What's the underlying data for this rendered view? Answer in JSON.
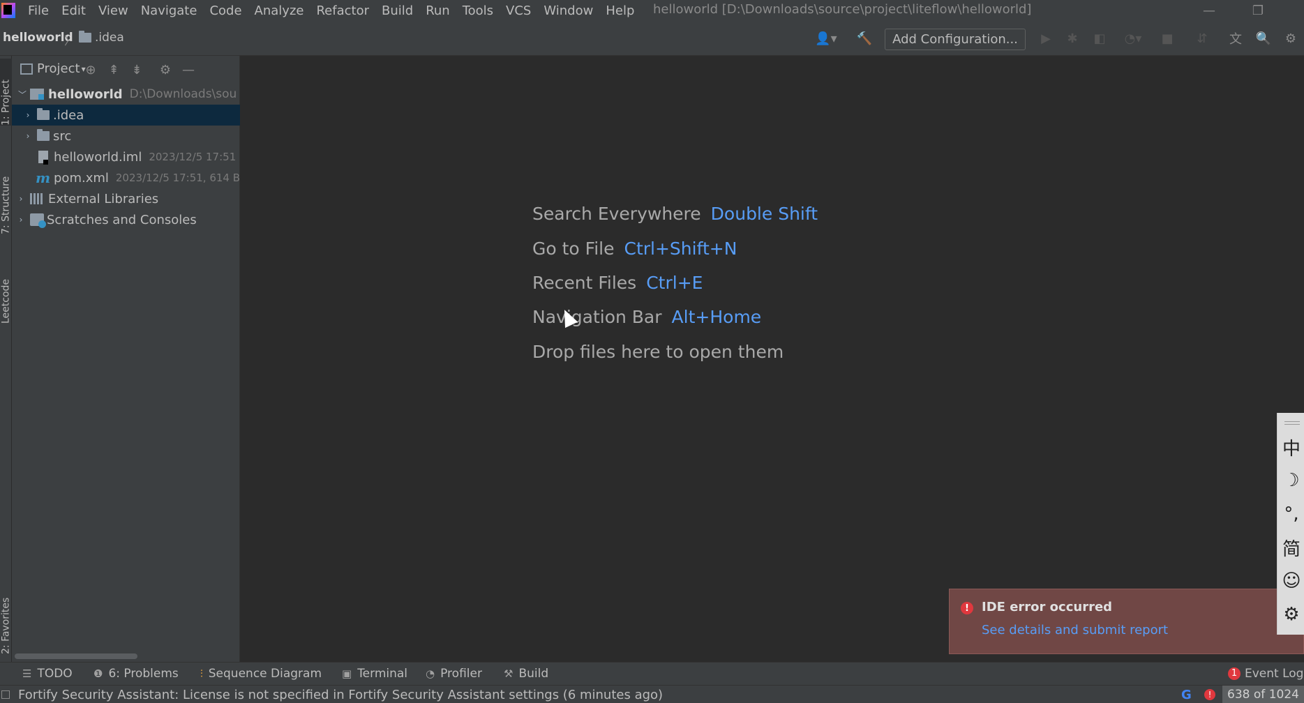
{
  "menu": [
    "File",
    "Edit",
    "View",
    "Navigate",
    "Code",
    "Analyze",
    "Refactor",
    "Build",
    "Run",
    "Tools",
    "VCS",
    "Window",
    "Help"
  ],
  "window_title": "helloworld [D:\\Downloads\\source\\project\\liteflow\\helloworld]",
  "breadcrumb": {
    "project": "helloworld",
    "folder": ".idea"
  },
  "toolbar": {
    "add_config": "Add Configuration..."
  },
  "left_tabs": {
    "project": "1: Project",
    "structure": "7: Structure",
    "leetcode": "Leetcode",
    "favorites": "2: Favorites"
  },
  "project_panel": {
    "title": "Project",
    "root": {
      "name": "helloworld",
      "path": "D:\\Downloads\\sou"
    },
    "items": [
      {
        "name": ".idea"
      },
      {
        "name": "src"
      },
      {
        "name": "helloworld.iml",
        "meta": "2023/12/5 17:51"
      },
      {
        "name": "pom.xml",
        "meta": "2023/12/5 17:51, 614 B"
      },
      {
        "name": "External Libraries"
      },
      {
        "name": "Scratches and Consoles"
      }
    ]
  },
  "hints": [
    {
      "label": "Search Everywhere",
      "key": "Double Shift"
    },
    {
      "label": "Go to File",
      "key": "Ctrl+Shift+N"
    },
    {
      "label": "Recent Files",
      "key": "Ctrl+E"
    },
    {
      "label": "Navigation Bar",
      "key": "Alt+Home"
    },
    {
      "label": "Drop files here to open them",
      "key": ""
    }
  ],
  "notification": {
    "title": "IDE error occurred",
    "link": "See details and submit report"
  },
  "ime": [
    "中",
    "☽",
    "°,",
    "简",
    "☺",
    "⚙"
  ],
  "bottom_tools": {
    "todo": "TODO",
    "problems": "6: Problems",
    "sequence": "Sequence Diagram",
    "terminal": "Terminal",
    "profiler": "Profiler",
    "build": "Build",
    "event_log": "Event Log",
    "event_count": "1"
  },
  "status": {
    "message": "Fortify Security Assistant: License is not specified in Fortify Security Assistant settings (6 minutes ago)",
    "memory": "638 of 1024"
  },
  "colors": {
    "accent_link": "#589df6",
    "error": "#e0383e",
    "selection": "#0d293e"
  }
}
